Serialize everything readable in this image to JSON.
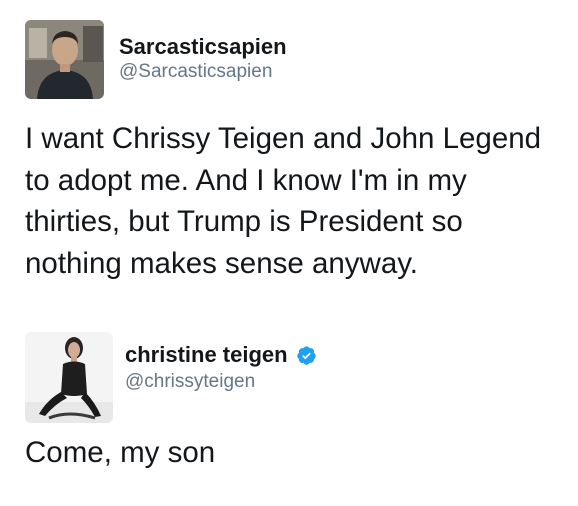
{
  "tweets": [
    {
      "author": {
        "name": "Sarcasticsapien",
        "handle": "@Sarcasticsapien",
        "verified": false
      },
      "text_lines": [
        "I want Chrissy Teigen and John Legend",
        "to adopt me. And I know I'm in my",
        "thirties, but Trump is President so",
        "nothing makes sense anyway."
      ]
    },
    {
      "author": {
        "name": "christine teigen",
        "handle": "@chrissyteigen",
        "verified": true
      },
      "text_lines": [
        "Come, my son"
      ]
    }
  ],
  "icons": {
    "verified_badge": "verified-badge-icon"
  },
  "colors": {
    "text": "#14171a",
    "handle": "#657786",
    "verified": "#1da1f2"
  }
}
